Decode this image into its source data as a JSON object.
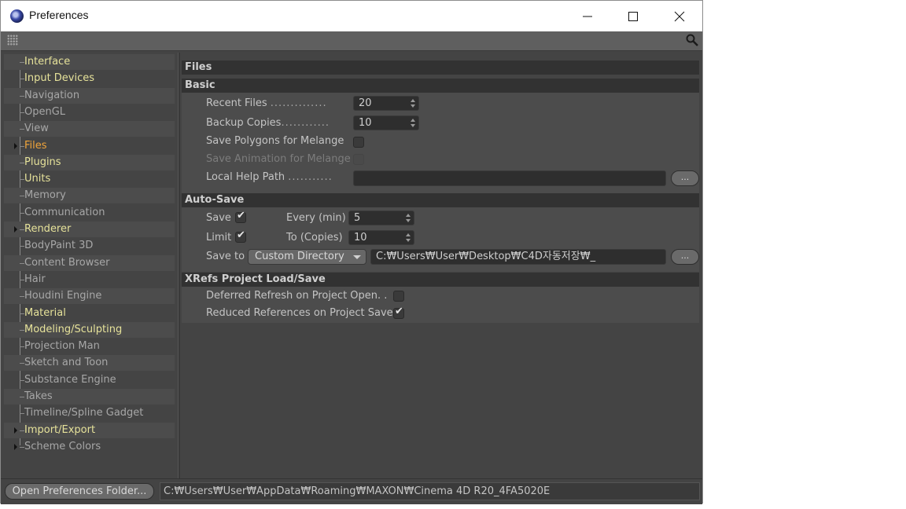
{
  "window": {
    "title": "Preferences",
    "controls": {
      "minimize": "minimize",
      "maximize": "maximize",
      "close": "close"
    }
  },
  "sidebar": {
    "items": [
      {
        "label": "Interface",
        "color": "#e6e29a",
        "expandable": false
      },
      {
        "label": "Input Devices",
        "color": "#e6e29a",
        "expandable": false
      },
      {
        "label": "Navigation",
        "color": "#a7a7a7",
        "expandable": false
      },
      {
        "label": "OpenGL",
        "color": "#a7a7a7",
        "expandable": false
      },
      {
        "label": "View",
        "color": "#a7a7a7",
        "expandable": false
      },
      {
        "label": "Files",
        "color": "#f0a43a",
        "expandable": true,
        "selected": true
      },
      {
        "label": "Plugins",
        "color": "#e6e29a",
        "expandable": false
      },
      {
        "label": "Units",
        "color": "#e6e29a",
        "expandable": false
      },
      {
        "label": "Memory",
        "color": "#a7a7a7",
        "expandable": false
      },
      {
        "label": "Communication",
        "color": "#a7a7a7",
        "expandable": false
      },
      {
        "label": "Renderer",
        "color": "#e6e29a",
        "expandable": true
      },
      {
        "label": "BodyPaint 3D",
        "color": "#a7a7a7",
        "expandable": false
      },
      {
        "label": "Content Browser",
        "color": "#a7a7a7",
        "expandable": false
      },
      {
        "label": "Hair",
        "color": "#a7a7a7",
        "expandable": false
      },
      {
        "label": "Houdini Engine",
        "color": "#a7a7a7",
        "expandable": false
      },
      {
        "label": "Material",
        "color": "#e6e29a",
        "expandable": false
      },
      {
        "label": "Modeling/Sculpting",
        "color": "#e6e29a",
        "expandable": false
      },
      {
        "label": "Projection Man",
        "color": "#a7a7a7",
        "expandable": false
      },
      {
        "label": "Sketch and Toon",
        "color": "#a7a7a7",
        "expandable": false
      },
      {
        "label": "Substance Engine",
        "color": "#a7a7a7",
        "expandable": false
      },
      {
        "label": "Takes",
        "color": "#a7a7a7",
        "expandable": false
      },
      {
        "label": "Timeline/Spline Gadget",
        "color": "#a7a7a7",
        "expandable": false
      },
      {
        "label": "Import/Export",
        "color": "#e6e29a",
        "expandable": true
      },
      {
        "label": "Scheme Colors",
        "color": "#a7a7a7",
        "expandable": true
      }
    ]
  },
  "main": {
    "title": "Files",
    "basic": {
      "header": "Basic",
      "recent_files_label": "Recent Files",
      "recent_files_value": "20",
      "backup_copies_label": "Backup Copies",
      "backup_copies_value": "10",
      "save_polygons_label": "Save Polygons for Melange",
      "save_polygons_checked": false,
      "save_animation_label": "Save Animation for Melange",
      "save_animation_checked": false,
      "local_help_label": "Local Help Path",
      "local_help_value": "",
      "browse_label": "..."
    },
    "autosave": {
      "header": "Auto-Save",
      "save_label": "Save",
      "save_checked": true,
      "every_label": "Every (min)",
      "every_value": "5",
      "limit_label": "Limit",
      "limit_checked": true,
      "to_label": "To (Copies)",
      "to_value": "10",
      "save_to_label": "Save to",
      "save_to_option": "Custom Directory",
      "save_to_path": "C:₩Users₩User₩Desktop₩C4D자동저장₩_",
      "browse_label": "..."
    },
    "xrefs": {
      "header": "XRefs Project Load/Save",
      "deferred_label": "Deferred Refresh on Project Open. .",
      "deferred_checked": false,
      "reduced_label": "Reduced References on Project Save",
      "reduced_checked": true
    }
  },
  "footer": {
    "open_folder_label": "Open Preferences Folder...",
    "path": "C:₩Users₩User₩AppData₩Roaming₩MAXON₩Cinema 4D R20_4FA5020E"
  },
  "check_glyph": "✔"
}
